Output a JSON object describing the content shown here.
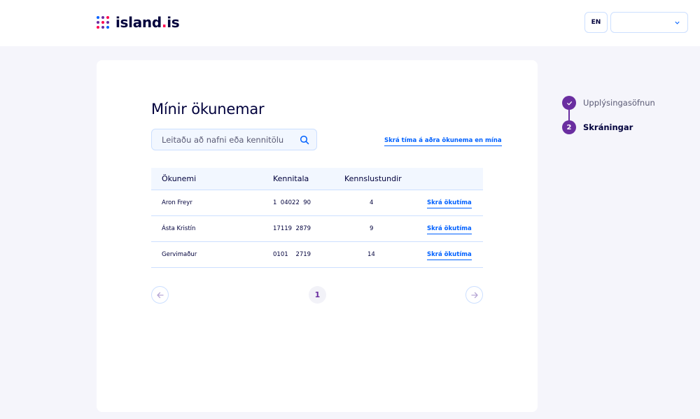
{
  "header": {
    "logo_text": "island",
    "logo_dot": ".",
    "logo_suffix": "is",
    "lang_button": "EN",
    "user_select_value": ""
  },
  "main": {
    "title": "Mínir ökunemar",
    "search_placeholder": "Leitaðu að nafni eða kennitölu",
    "other_student_link": "Skrá tíma á aðra ökunema en mína"
  },
  "table": {
    "headers": [
      "Ökunemi",
      "Kennitala",
      "Kennslustundir"
    ],
    "rows": [
      {
        "name": "Aron Freyr",
        "kennitala": "1  04022  90",
        "hours": "4",
        "action": "Skrá ökutíma"
      },
      {
        "name": "Ásta Kristín",
        "kennitala": "17119  2879",
        "hours": "9",
        "action": "Skrá ökutíma"
      },
      {
        "name": "Gervimaður",
        "kennitala": "0101    2719",
        "hours": "14",
        "action": "Skrá ökutíma"
      }
    ]
  },
  "pagination": {
    "current_page": "1"
  },
  "stepper": {
    "steps": [
      {
        "number": "1",
        "label": "Upplýsingasöfnun",
        "status": "done"
      },
      {
        "number": "2",
        "label": "Skráningar",
        "status": "active"
      }
    ]
  },
  "colors": {
    "primary": "#0061ff",
    "accent_purple": "#6a2ea0",
    "brand_red": "#ff0050",
    "text_dark": "#00003c",
    "background": "#f5f5fb"
  },
  "icons": {
    "search": "search-icon",
    "chevron": "chevron-down-icon",
    "prev": "arrow-left-icon",
    "next": "arrow-right-icon",
    "check": "check-icon"
  }
}
